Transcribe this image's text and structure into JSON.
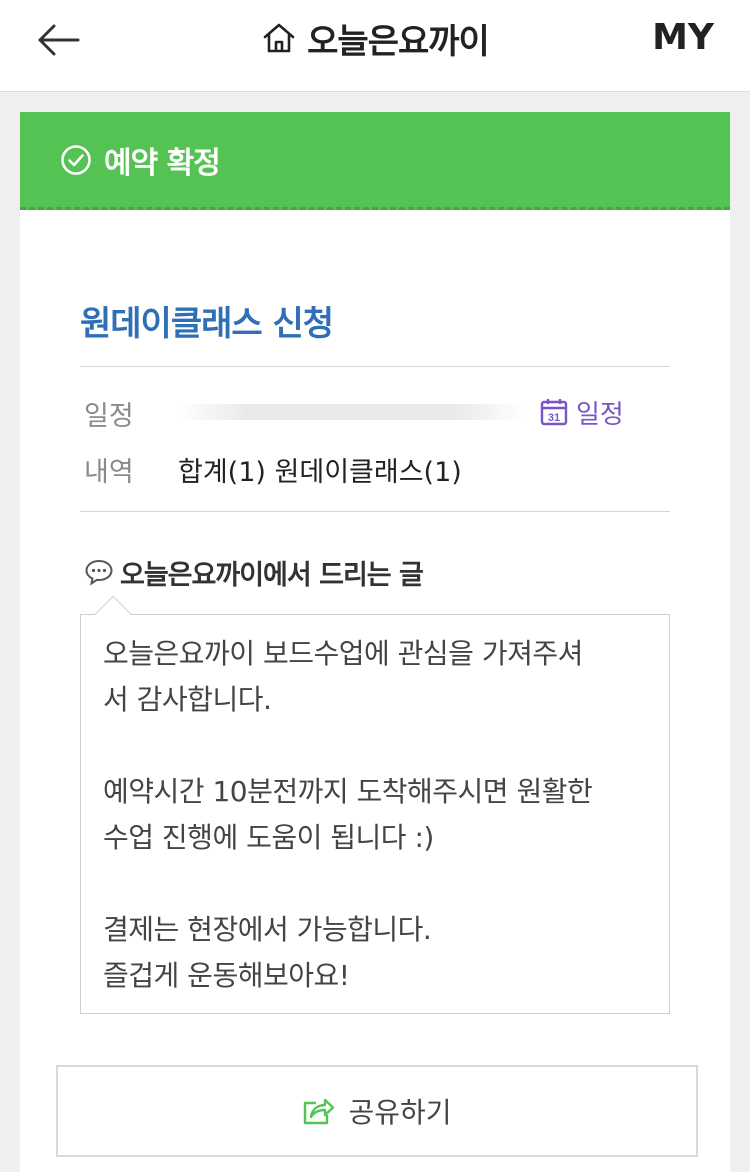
{
  "header": {
    "title": "오늘은요까이",
    "my_label": "MY"
  },
  "status": {
    "label": "예약 확정",
    "color": "#55c353"
  },
  "section": {
    "title": "원데이클래스 신청"
  },
  "details": {
    "schedule_label": "일정",
    "calendar_link": "일정",
    "calendar_icon_text": "31",
    "items_label": "내역",
    "items_value": "합계(1) 원데이클래스(1)"
  },
  "message": {
    "heading": "오늘은요까이에서 드리는 글",
    "lines": [
      "오늘은요까이 보드수업에 관심을 가져주셔",
      "서 감사합니다.",
      "",
      "예약시간 10분전까지 도착해주시면 원활한",
      "수업 진행에 도움이 됩니다 :)",
      "",
      "결제는 현장에서 가능합니다.",
      "즐겁게 운동해보아요!"
    ]
  },
  "share": {
    "label": "공유하기"
  }
}
